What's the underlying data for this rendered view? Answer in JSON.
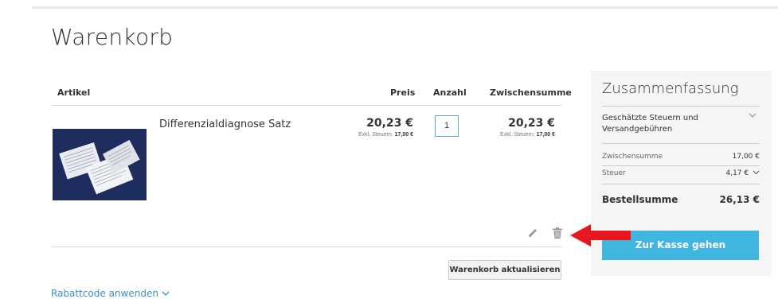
{
  "page": {
    "title": "Warenkorb"
  },
  "cart": {
    "columns": {
      "artikel": "Artikel",
      "preis": "Preis",
      "anzahl": "Anzahl",
      "zwischensumme": "Zwischensumme"
    },
    "item": {
      "name": "Differenzialdiagnose Satz",
      "price": "20,23 €",
      "price_note_label": "Exkl. Steuern:",
      "price_note_value": "17,00 €",
      "quantity": "1",
      "subtotal": "20,23 €",
      "subtotal_note_label": "Exkl. Steuern:",
      "subtotal_note_value": "17,00 €"
    },
    "update_button": "Warenkorb aktualisieren",
    "discount_link": "Rabattcode anwenden"
  },
  "summary": {
    "title": "Zusammenfassung",
    "tax_shipping_label": "Geschätzte Steuern und Versandgebühren",
    "subtotal_label": "Zwischensumme",
    "subtotal_value": "17,00 €",
    "tax_label": "Steuer",
    "tax_value": "4,17 €",
    "total_label": "Bestellsumme",
    "total_value": "26,13 €",
    "checkout_button": "Zur Kasse gehen"
  },
  "colors": {
    "accent_blue": "#3fb5e0",
    "link_blue": "#3d8fc5",
    "arrow_red": "#e8161e"
  },
  "icons": [
    "pencil-icon",
    "trash-icon",
    "chevron-down-icon",
    "red-arrow-icon"
  ]
}
